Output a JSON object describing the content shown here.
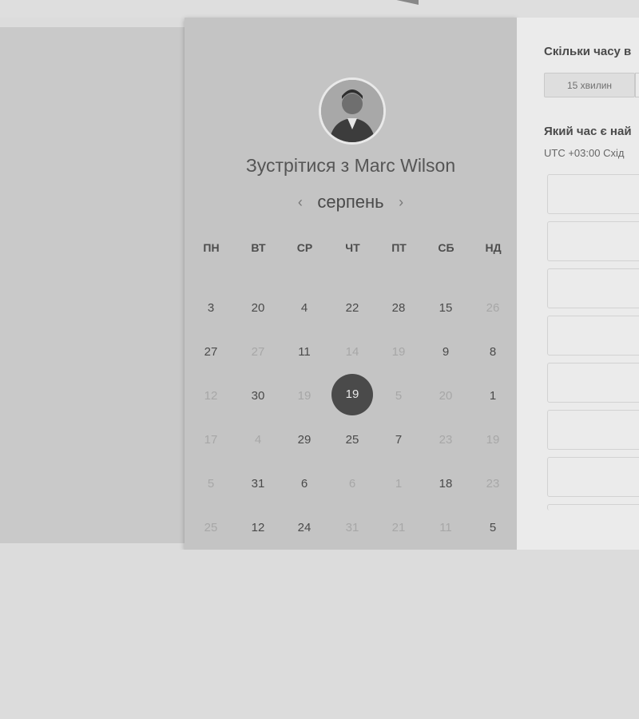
{
  "header": {
    "arrow_icon": "caret-down-icon"
  },
  "calendar": {
    "avatar_icon": "user-avatar",
    "title": "Зустрітися з Marc Wilson",
    "month": "серпень",
    "prev_icon": "chevron-left-icon",
    "next_icon": "chevron-right-icon",
    "weekdays": [
      "ПН",
      "ВТ",
      "СР",
      "ЧТ",
      "ПТ",
      "СБ",
      "НД"
    ],
    "weeks": [
      [
        {
          "d": "3",
          "a": true
        },
        {
          "d": "20",
          "a": true
        },
        {
          "d": "4",
          "a": true
        },
        {
          "d": "22",
          "a": true
        },
        {
          "d": "28",
          "a": true
        },
        {
          "d": "15",
          "a": true
        },
        {
          "d": "26",
          "a": false
        }
      ],
      [
        {
          "d": "27",
          "a": true
        },
        {
          "d": "27",
          "a": false
        },
        {
          "d": "11",
          "a": true
        },
        {
          "d": "14",
          "a": false
        },
        {
          "d": "19",
          "a": false
        },
        {
          "d": "9",
          "a": true
        },
        {
          "d": "8",
          "a": true
        }
      ],
      [
        {
          "d": "12",
          "a": false
        },
        {
          "d": "30",
          "a": true
        },
        {
          "d": "19",
          "a": false
        },
        {
          "d": "19",
          "a": true,
          "selected": true
        },
        {
          "d": "5",
          "a": false
        },
        {
          "d": "20",
          "a": false
        },
        {
          "d": "1",
          "a": true
        }
      ],
      [
        {
          "d": "17",
          "a": false
        },
        {
          "d": "4",
          "a": false
        },
        {
          "d": "29",
          "a": true
        },
        {
          "d": "25",
          "a": true
        },
        {
          "d": "7",
          "a": true
        },
        {
          "d": "23",
          "a": false
        },
        {
          "d": "19",
          "a": false
        }
      ],
      [
        {
          "d": "5",
          "a": false
        },
        {
          "d": "31",
          "a": true
        },
        {
          "d": "6",
          "a": true
        },
        {
          "d": "6",
          "a": false
        },
        {
          "d": "1",
          "a": false
        },
        {
          "d": "18",
          "a": true
        },
        {
          "d": "23",
          "a": false
        }
      ],
      [
        {
          "d": "25",
          "a": false
        },
        {
          "d": "12",
          "a": true
        },
        {
          "d": "24",
          "a": true
        },
        {
          "d": "31",
          "a": false
        },
        {
          "d": "21",
          "a": false
        },
        {
          "d": "11",
          "a": false
        },
        {
          "d": "5",
          "a": true
        }
      ]
    ]
  },
  "booking": {
    "duration_question": "Скільки часу в",
    "duration_option": "15 хвилин",
    "time_question": "Який час є най",
    "timezone": "UTC +03:00 Схід",
    "slots": [
      "",
      "",
      "",
      "",
      "",
      "",
      ""
    ]
  }
}
